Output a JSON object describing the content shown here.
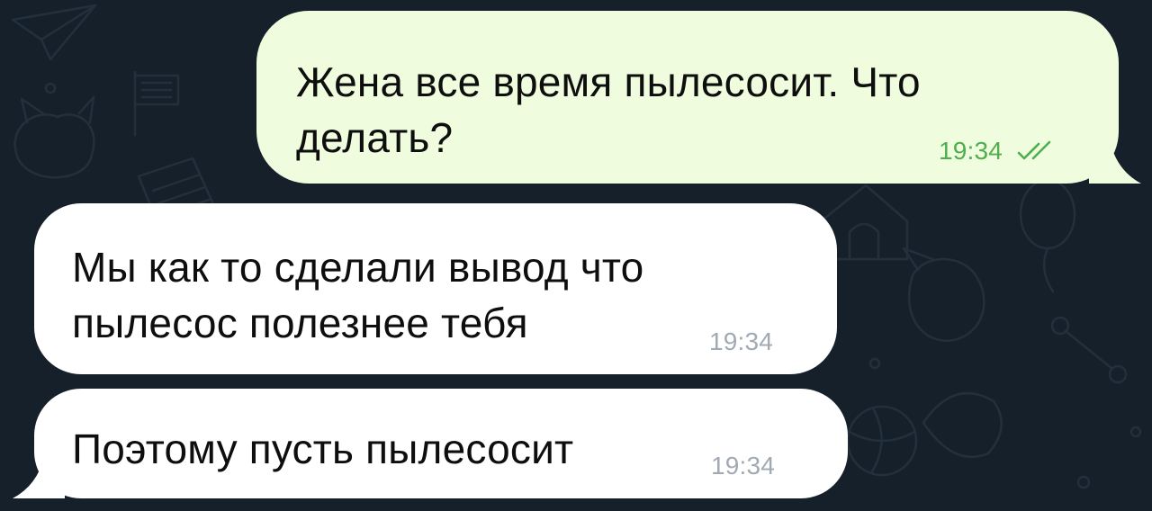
{
  "colors": {
    "background": "#16202b",
    "outgoing_bubble": "#effdde",
    "incoming_bubble": "#ffffff",
    "outgoing_time": "#4fae4e",
    "incoming_time": "#a1aab3"
  },
  "messages": [
    {
      "direction": "outgoing",
      "lines": [
        "Жена все время пылесосит. Что",
        "делать?"
      ],
      "time": "19:34",
      "status_icon": "double-check-icon"
    },
    {
      "direction": "incoming",
      "lines": [
        "Мы как то сделали вывод что",
        "пылесос полезнее тебя"
      ],
      "time": "19:34"
    },
    {
      "direction": "incoming",
      "lines": [
        "Поэтому пусть пылесосит"
      ],
      "time": "19:34"
    }
  ]
}
